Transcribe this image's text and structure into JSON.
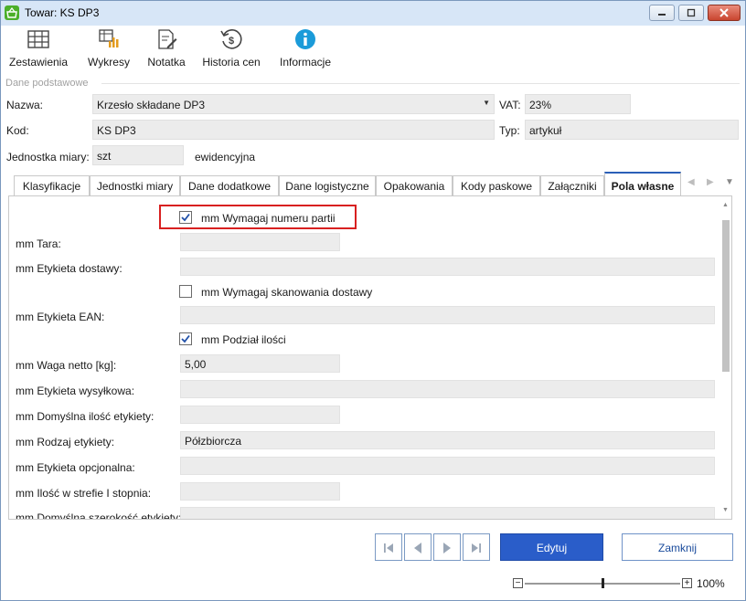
{
  "window": {
    "title": "Towar: KS DP3"
  },
  "toolbar": [
    {
      "label": "Zestawienia",
      "icon": "table-icon"
    },
    {
      "label": "Wykresy",
      "icon": "chart-icon"
    },
    {
      "label": "Notatka",
      "icon": "note-icon"
    },
    {
      "label": "Historia cen",
      "icon": "history-icon"
    },
    {
      "label": "Informacje",
      "icon": "info-icon"
    }
  ],
  "group": {
    "title": "Dane podstawowe"
  },
  "header": {
    "nazwa_label": "Nazwa:",
    "nazwa_value": "Krzesło składane DP3",
    "vat_label": "VAT:",
    "vat_value": "23%",
    "kod_label": "Kod:",
    "kod_value": "KS DP3",
    "typ_label": "Typ:",
    "typ_value": "artykuł",
    "jm_label": "Jednostka miary:",
    "jm_value": "szt",
    "jm_note": "ewidencyjna"
  },
  "tabs": [
    {
      "label": "Klasyfikacje"
    },
    {
      "label": "Jednostki miary"
    },
    {
      "label": "Dane dodatkowe"
    },
    {
      "label": "Dane logistyczne"
    },
    {
      "label": "Opakowania"
    },
    {
      "label": "Kody paskowe"
    },
    {
      "label": "Załączniki"
    },
    {
      "label": "Pola własne"
    }
  ],
  "active_tab": "Pola własne",
  "fields": {
    "wymagaj_partii": {
      "label": "mm Wymagaj numeru partii",
      "checked": true
    },
    "tara": {
      "label": "mm Tara:",
      "value": ""
    },
    "etykieta_dostawy": {
      "label": "mm Etykieta dostawy:",
      "value": ""
    },
    "wymagaj_skanowania": {
      "label": "mm Wymagaj skanowania dostawy",
      "checked": false
    },
    "etykieta_ean": {
      "label": "mm Etykieta EAN:",
      "value": ""
    },
    "podzial_ilosci": {
      "label": "mm Podział ilości",
      "checked": true
    },
    "waga_netto": {
      "label": "mm Waga netto [kg]:",
      "value": "5,00"
    },
    "etykieta_wysylkowa": {
      "label": "mm Etykieta wysyłkowa:",
      "value": ""
    },
    "domyslna_ilosc": {
      "label": "mm Domyślna ilość etykiety:",
      "value": ""
    },
    "rodzaj_etykiety": {
      "label": "mm Rodzaj etykiety:",
      "value": "Półzbiorcza"
    },
    "etykieta_opcjonalna": {
      "label": "mm Etykieta opcjonalna:",
      "value": ""
    },
    "ilosc_strefie": {
      "label": "mm Ilość w strefie I stopnia:",
      "value": ""
    },
    "cut_row": {
      "label": "mm Domyślna szerokość etykiety:"
    }
  },
  "buttons": {
    "edit": "Edytuj",
    "close": "Zamknij"
  },
  "zoom": {
    "percent": "100%",
    "minus": "−",
    "plus": "+"
  },
  "colors": {
    "accent": "#2a5dc9",
    "highlight": "#d82020",
    "titlebar": "#d7e6f7"
  }
}
